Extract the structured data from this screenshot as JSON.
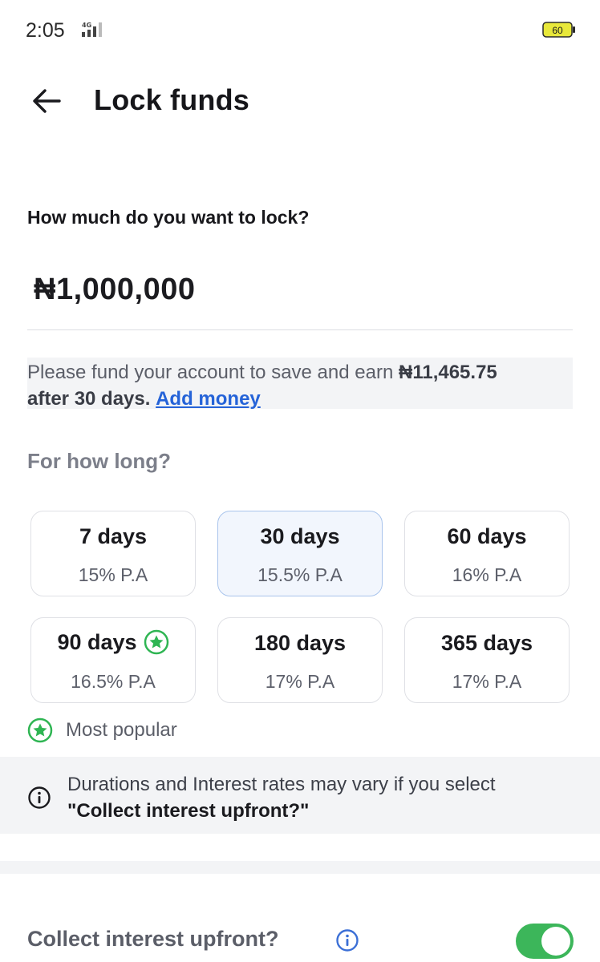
{
  "status_bar": {
    "time": "2:05",
    "network": "4G",
    "battery": "60"
  },
  "header": {
    "title": "Lock funds",
    "back_icon": "arrow-left-icon"
  },
  "amount_section": {
    "question": "How much do you want to lock?",
    "amount": "₦1,000,000"
  },
  "fund_notice": {
    "text_prefix": "Please fund your account to save and earn ",
    "earn_amount": "₦11,465.75",
    "text_suffix": "after 30 days.",
    "link_label": "Add money"
  },
  "duration_section": {
    "heading": "For how long?",
    "options": [
      {
        "label": "7 days",
        "rate": "15% P.A",
        "selected": false,
        "popular": false
      },
      {
        "label": "30 days",
        "rate": "15.5% P.A",
        "selected": true,
        "popular": false
      },
      {
        "label": "60 days",
        "rate": "16% P.A",
        "selected": false,
        "popular": false
      },
      {
        "label": "90 days",
        "rate": "16.5% P.A",
        "selected": false,
        "popular": true
      },
      {
        "label": "180 days",
        "rate": "17% P.A",
        "selected": false,
        "popular": false
      },
      {
        "label": "365 days",
        "rate": "17% P.A",
        "selected": false,
        "popular": false
      }
    ],
    "popular_legend": "Most popular"
  },
  "info_banner": {
    "icon": "info-icon",
    "text": "Durations and Interest rates may vary if you select",
    "emphasis": "\"Collect interest upfront?\""
  },
  "collect_interest": {
    "label": "Collect interest upfront?",
    "enabled": true
  },
  "colors": {
    "accent_green": "#3cb65a",
    "link_blue": "#2563d8",
    "selected_bg": "#f2f6fd",
    "selected_border": "#a9c4ec"
  }
}
